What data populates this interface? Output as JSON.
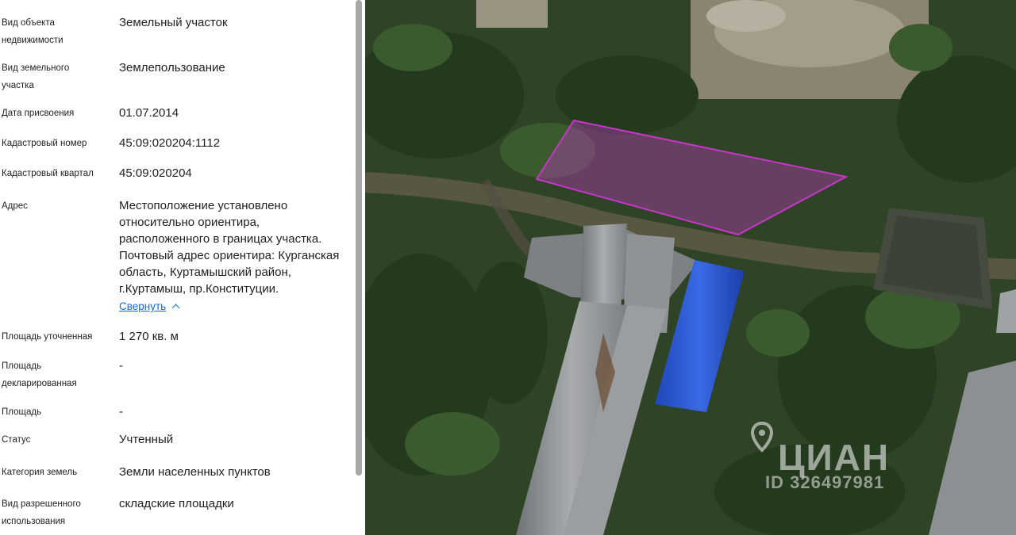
{
  "properties": [
    {
      "label": "Вид объекта недвижимости",
      "value": "Земельный участок"
    },
    {
      "label": "Вид земельного участка",
      "value": "Землепользование"
    },
    {
      "label": "Дата присвоения",
      "value": "01.07.2014"
    },
    {
      "label": "Кадастровый номер",
      "value": "45:09:020204:1112"
    },
    {
      "label": "Кадастровый квартал",
      "value": "45:09:020204"
    },
    {
      "label": "Адрес",
      "value": "Местоположение установлено относительно ориентира, расположенного в границах участка. Почтовый адрес ориентира: Курганская область, Куртамышский район, г.Куртамыш, пр.Конституции."
    },
    {
      "label": "Площадь уточненная",
      "value": "1 270 кв. м"
    },
    {
      "label": "Площадь декларированная",
      "value": "-"
    },
    {
      "label": "Площадь",
      "value": "-"
    },
    {
      "label": "Статус",
      "value": "Учтенный"
    },
    {
      "label": "Категория земель",
      "value": "Земли населенных пунктов"
    },
    {
      "label": "Вид разрешенного использования",
      "value": "складские площадки"
    }
  ],
  "address_toggle": {
    "label": "Свернуть",
    "icon": "chevron-up-icon"
  },
  "map": {
    "watermark_brand": "ЦИАН",
    "watermark_id": "ID 326497981",
    "watermark_icon": "location-pin-icon",
    "parcel_color": "#c636c8"
  }
}
